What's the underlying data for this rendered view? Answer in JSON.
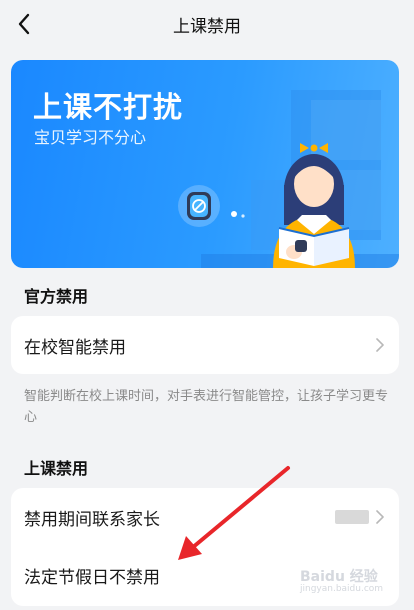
{
  "header": {
    "title": "上课禁用",
    "back_icon": "chevron-left-icon"
  },
  "banner": {
    "title": "上课不打扰",
    "subtitle": "宝贝学习不分心",
    "colors": {
      "start": "#1a88ff",
      "end": "#4eb0ff"
    }
  },
  "official": {
    "section_title": "官方禁用",
    "items": [
      {
        "label": "在校智能禁用",
        "icon": "chevron-right-icon"
      }
    ],
    "note": "智能判断在校上课时间，对手表进行智能管控，让孩子学习更专心"
  },
  "class_ban": {
    "section_title": "上课禁用",
    "items": [
      {
        "label": "禁用期间联系家长",
        "icon": "chevron-right-icon"
      },
      {
        "label": "法定节假日不禁用"
      }
    ]
  },
  "watermark": {
    "text": "Baidu 经验",
    "sub": "jingyan.baidu.com"
  },
  "colors": {
    "accent": "#1a88ff",
    "annotation": "#e8262a",
    "background": "#f2f3f5"
  }
}
